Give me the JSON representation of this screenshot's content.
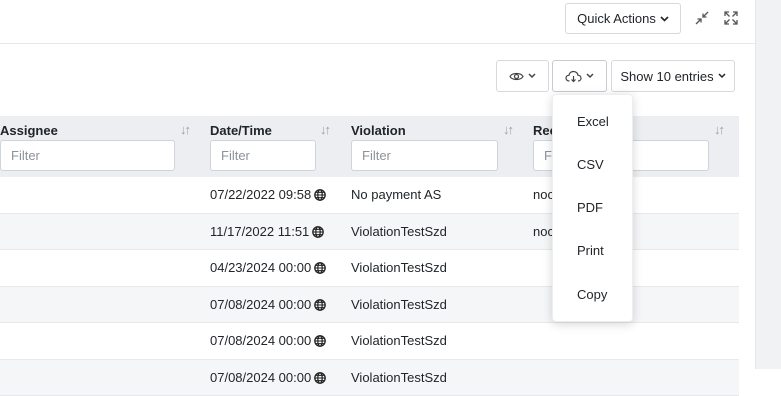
{
  "header": {
    "quick_actions_label": "Quick Actions"
  },
  "toolbar": {
    "show_entries_label": "Show 10 entries"
  },
  "columns": [
    {
      "label": "Assignee",
      "filter_placeholder": "Filter"
    },
    {
      "label": "Date/Time",
      "filter_placeholder": "Filter"
    },
    {
      "label": "Violation",
      "filter_placeholder": "Filter"
    },
    {
      "label": "Rec",
      "filter_placeholder": "F"
    }
  ],
  "rows": [
    {
      "assignee": "",
      "datetime": "07/22/2022 09:58",
      "violation": "No payment AS",
      "rec": "noc"
    },
    {
      "assignee": "",
      "datetime": "11/17/2022 11:51",
      "violation": "ViolationTestSzd",
      "rec": "noc"
    },
    {
      "assignee": "",
      "datetime": "04/23/2024 00:00",
      "violation": "ViolationTestSzd",
      "rec": ""
    },
    {
      "assignee": "",
      "datetime": "07/08/2024 00:00",
      "violation": "ViolationTestSzd",
      "rec": ""
    },
    {
      "assignee": "",
      "datetime": "07/08/2024 00:00",
      "violation": "ViolationTestSzd",
      "rec": ""
    },
    {
      "assignee": "",
      "datetime": "07/08/2024 00:00",
      "violation": "ViolationTestSzd",
      "rec": ""
    }
  ],
  "export_menu": {
    "items": [
      "Excel",
      "CSV",
      "PDF",
      "Print",
      "Copy"
    ]
  },
  "icons": {
    "minimize": "compress-icon",
    "expand": "expand-icon",
    "visibility": "eye-icon",
    "export": "cloud-download-icon",
    "timezone": "globe-icon",
    "sort": "sort-icon"
  }
}
